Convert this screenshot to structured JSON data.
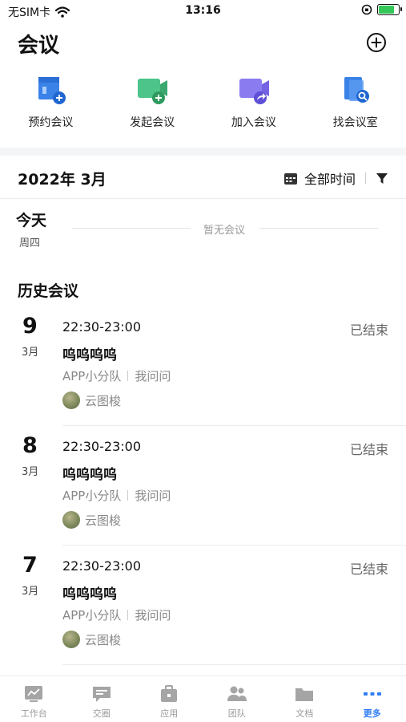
{
  "status_bar": {
    "carrier": "无SIM卡",
    "time": "13:16"
  },
  "header": {
    "title": "会议"
  },
  "quick_actions": [
    {
      "label": "预约会议",
      "icon": "calendar-schedule-icon"
    },
    {
      "label": "发起会议",
      "icon": "video-start-icon"
    },
    {
      "label": "加入会议",
      "icon": "video-join-icon"
    },
    {
      "label": "找会议室",
      "icon": "room-search-icon"
    }
  ],
  "month_bar": {
    "month": "2022年 3月",
    "filter_label": "全部时间"
  },
  "today": {
    "label": "今天",
    "weekday": "周四",
    "empty_text": "暂无会议"
  },
  "history": {
    "title": "历史会议",
    "meetings": [
      {
        "day": "9",
        "month": "3月",
        "time": "22:30-23:00",
        "status": "已结束",
        "title": "呜呜呜呜",
        "team": "APP小分队",
        "role": "我问问",
        "person": "云图梭"
      },
      {
        "day": "8",
        "month": "3月",
        "time": "22:30-23:00",
        "status": "已结束",
        "title": "呜呜呜呜",
        "team": "APP小分队",
        "role": "我问问",
        "person": "云图梭"
      },
      {
        "day": "7",
        "month": "3月",
        "time": "22:30-23:00",
        "status": "已结束",
        "title": "呜呜呜呜",
        "team": "APP小分队",
        "role": "我问问",
        "person": "云图梭"
      }
    ]
  },
  "tabs": [
    {
      "label": "工作台",
      "icon": "workbench-icon"
    },
    {
      "label": "交圈",
      "icon": "chat-icon"
    },
    {
      "label": "应用",
      "icon": "apps-icon"
    },
    {
      "label": "团队",
      "icon": "team-icon"
    },
    {
      "label": "文档",
      "icon": "folder-icon"
    },
    {
      "label": "更多",
      "icon": "more-icon",
      "active": true
    }
  ],
  "colors": {
    "accent": "#2f7cf6",
    "muted": "#888888",
    "tab_inactive": "#9a9a9a"
  }
}
